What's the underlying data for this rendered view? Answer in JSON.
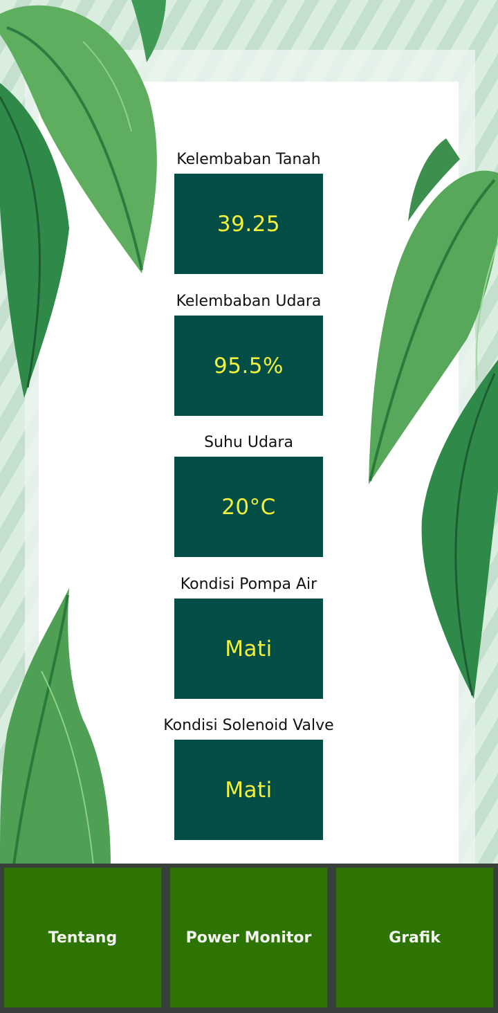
{
  "sensors": [
    {
      "label": "Kelembaban Tanah",
      "value": "39.25"
    },
    {
      "label": "Kelembaban Udara",
      "value": "95.5%"
    },
    {
      "label": "Suhu Udara",
      "value": "20°C"
    },
    {
      "label": "Kondisi Pompa Air",
      "value": "Mati"
    },
    {
      "label": "Kondisi Solenoid Valve",
      "value": "Mati"
    }
  ],
  "nav": {
    "about_label": "Tentang",
    "power_label": "Power Monitor",
    "chart_label": "Grafik"
  },
  "colors": {
    "value_box": "#034d47",
    "value_text": "#f2f23b",
    "nav_button": "#2e7402",
    "nav_bar": "#3b3f3c"
  }
}
